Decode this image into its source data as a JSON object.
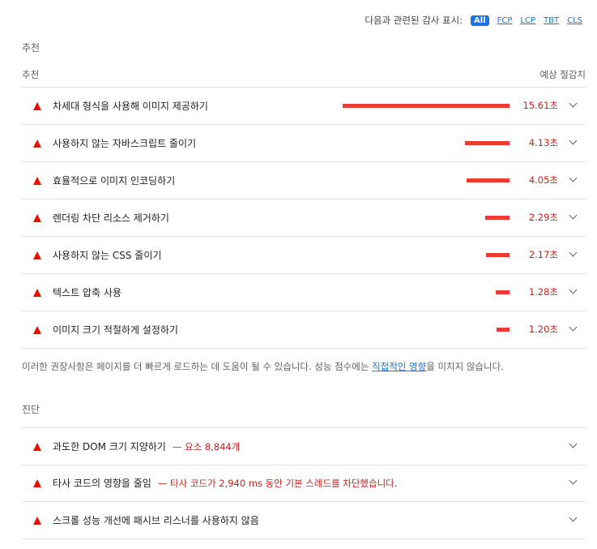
{
  "filter": {
    "label": "다음과 관련된 감사 표시:",
    "options": [
      "All",
      "FCP",
      "LCP",
      "TBT",
      "CLS"
    ]
  },
  "opportunities": {
    "section_title": "추천",
    "column_left": "추천",
    "column_right": "예상 절감치",
    "items": [
      {
        "title": "차세대 형식을 사용해 이미지 제공하기",
        "savings": "15.61초",
        "savings_seconds": 15.61
      },
      {
        "title": "사용하지 않는 자바스크립트 줄이기",
        "savings": "4.13초",
        "savings_seconds": 4.13
      },
      {
        "title": "효율적으로 이미지 인코딩하기",
        "savings": "4.05초",
        "savings_seconds": 4.05
      },
      {
        "title": "렌더링 차단 리소스 제거하기",
        "savings": "2.29초",
        "savings_seconds": 2.29
      },
      {
        "title": "사용하지 않는 CSS 줄이기",
        "savings": "2.17초",
        "savings_seconds": 2.17
      },
      {
        "title": "텍스트 압축 사용",
        "savings": "1.28초",
        "savings_seconds": 1.28
      },
      {
        "title": "이미지 크기 적절하게 설정하기",
        "savings": "1.20초",
        "savings_seconds": 1.2
      }
    ],
    "note_before": "이러한 권장사항은 페이지를 더 빠르게 로드하는 데 도움이 될 수 있습니다. 성능 점수에는 ",
    "note_link": "직접적인 영향",
    "note_after": "을 미치지 않습니다."
  },
  "diagnostics": {
    "section_title": "진단",
    "items": [
      {
        "title": "과도한 DOM 크기 지양하기",
        "detail": "— 요소 8,844개"
      },
      {
        "title": "타사 코드의 영향을 줄임",
        "detail": "— 타사 코드가 2,940 ms 동안 기본 스레드를 차단했습니다."
      },
      {
        "title": "스크롤 성능 개선에 패시브 리스너를 사용하지 않음",
        "detail": ""
      }
    ]
  },
  "colors": {
    "fail": "#eb0f00",
    "accent": "#1a73e8",
    "savings_text": "#c7221f"
  }
}
